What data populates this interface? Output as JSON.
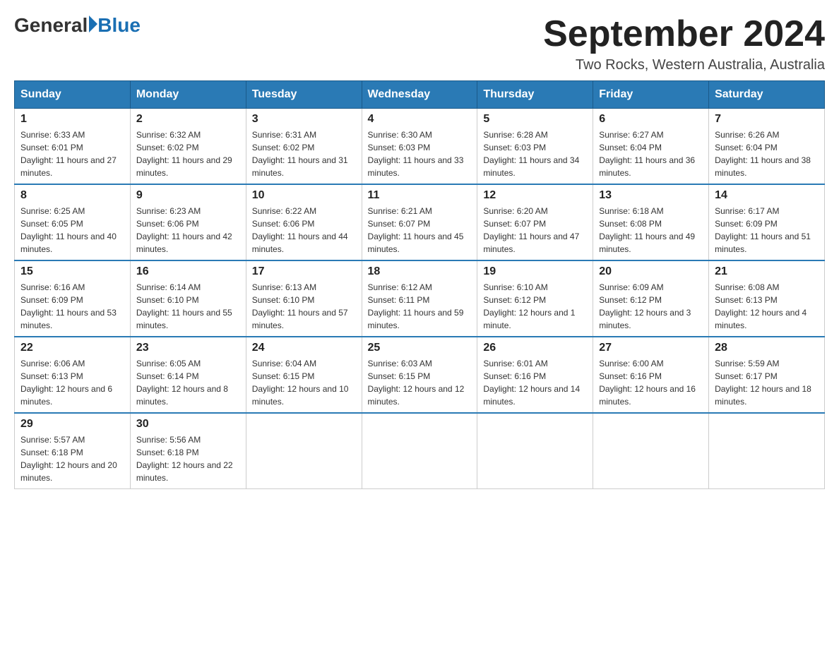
{
  "header": {
    "logo_general": "General",
    "logo_blue": "Blue",
    "title": "September 2024",
    "subtitle": "Two Rocks, Western Australia, Australia"
  },
  "calendar": {
    "days_of_week": [
      "Sunday",
      "Monday",
      "Tuesday",
      "Wednesday",
      "Thursday",
      "Friday",
      "Saturday"
    ],
    "weeks": [
      [
        {
          "date": "1",
          "sunrise": "6:33 AM",
          "sunset": "6:01 PM",
          "daylight": "11 hours and 27 minutes."
        },
        {
          "date": "2",
          "sunrise": "6:32 AM",
          "sunset": "6:02 PM",
          "daylight": "11 hours and 29 minutes."
        },
        {
          "date": "3",
          "sunrise": "6:31 AM",
          "sunset": "6:02 PM",
          "daylight": "11 hours and 31 minutes."
        },
        {
          "date": "4",
          "sunrise": "6:30 AM",
          "sunset": "6:03 PM",
          "daylight": "11 hours and 33 minutes."
        },
        {
          "date": "5",
          "sunrise": "6:28 AM",
          "sunset": "6:03 PM",
          "daylight": "11 hours and 34 minutes."
        },
        {
          "date": "6",
          "sunrise": "6:27 AM",
          "sunset": "6:04 PM",
          "daylight": "11 hours and 36 minutes."
        },
        {
          "date": "7",
          "sunrise": "6:26 AM",
          "sunset": "6:04 PM",
          "daylight": "11 hours and 38 minutes."
        }
      ],
      [
        {
          "date": "8",
          "sunrise": "6:25 AM",
          "sunset": "6:05 PM",
          "daylight": "11 hours and 40 minutes."
        },
        {
          "date": "9",
          "sunrise": "6:23 AM",
          "sunset": "6:06 PM",
          "daylight": "11 hours and 42 minutes."
        },
        {
          "date": "10",
          "sunrise": "6:22 AM",
          "sunset": "6:06 PM",
          "daylight": "11 hours and 44 minutes."
        },
        {
          "date": "11",
          "sunrise": "6:21 AM",
          "sunset": "6:07 PM",
          "daylight": "11 hours and 45 minutes."
        },
        {
          "date": "12",
          "sunrise": "6:20 AM",
          "sunset": "6:07 PM",
          "daylight": "11 hours and 47 minutes."
        },
        {
          "date": "13",
          "sunrise": "6:18 AM",
          "sunset": "6:08 PM",
          "daylight": "11 hours and 49 minutes."
        },
        {
          "date": "14",
          "sunrise": "6:17 AM",
          "sunset": "6:09 PM",
          "daylight": "11 hours and 51 minutes."
        }
      ],
      [
        {
          "date": "15",
          "sunrise": "6:16 AM",
          "sunset": "6:09 PM",
          "daylight": "11 hours and 53 minutes."
        },
        {
          "date": "16",
          "sunrise": "6:14 AM",
          "sunset": "6:10 PM",
          "daylight": "11 hours and 55 minutes."
        },
        {
          "date": "17",
          "sunrise": "6:13 AM",
          "sunset": "6:10 PM",
          "daylight": "11 hours and 57 minutes."
        },
        {
          "date": "18",
          "sunrise": "6:12 AM",
          "sunset": "6:11 PM",
          "daylight": "11 hours and 59 minutes."
        },
        {
          "date": "19",
          "sunrise": "6:10 AM",
          "sunset": "6:12 PM",
          "daylight": "12 hours and 1 minute."
        },
        {
          "date": "20",
          "sunrise": "6:09 AM",
          "sunset": "6:12 PM",
          "daylight": "12 hours and 3 minutes."
        },
        {
          "date": "21",
          "sunrise": "6:08 AM",
          "sunset": "6:13 PM",
          "daylight": "12 hours and 4 minutes."
        }
      ],
      [
        {
          "date": "22",
          "sunrise": "6:06 AM",
          "sunset": "6:13 PM",
          "daylight": "12 hours and 6 minutes."
        },
        {
          "date": "23",
          "sunrise": "6:05 AM",
          "sunset": "6:14 PM",
          "daylight": "12 hours and 8 minutes."
        },
        {
          "date": "24",
          "sunrise": "6:04 AM",
          "sunset": "6:15 PM",
          "daylight": "12 hours and 10 minutes."
        },
        {
          "date": "25",
          "sunrise": "6:03 AM",
          "sunset": "6:15 PM",
          "daylight": "12 hours and 12 minutes."
        },
        {
          "date": "26",
          "sunrise": "6:01 AM",
          "sunset": "6:16 PM",
          "daylight": "12 hours and 14 minutes."
        },
        {
          "date": "27",
          "sunrise": "6:00 AM",
          "sunset": "6:16 PM",
          "daylight": "12 hours and 16 minutes."
        },
        {
          "date": "28",
          "sunrise": "5:59 AM",
          "sunset": "6:17 PM",
          "daylight": "12 hours and 18 minutes."
        }
      ],
      [
        {
          "date": "29",
          "sunrise": "5:57 AM",
          "sunset": "6:18 PM",
          "daylight": "12 hours and 20 minutes."
        },
        {
          "date": "30",
          "sunrise": "5:56 AM",
          "sunset": "6:18 PM",
          "daylight": "12 hours and 22 minutes."
        },
        null,
        null,
        null,
        null,
        null
      ]
    ]
  }
}
